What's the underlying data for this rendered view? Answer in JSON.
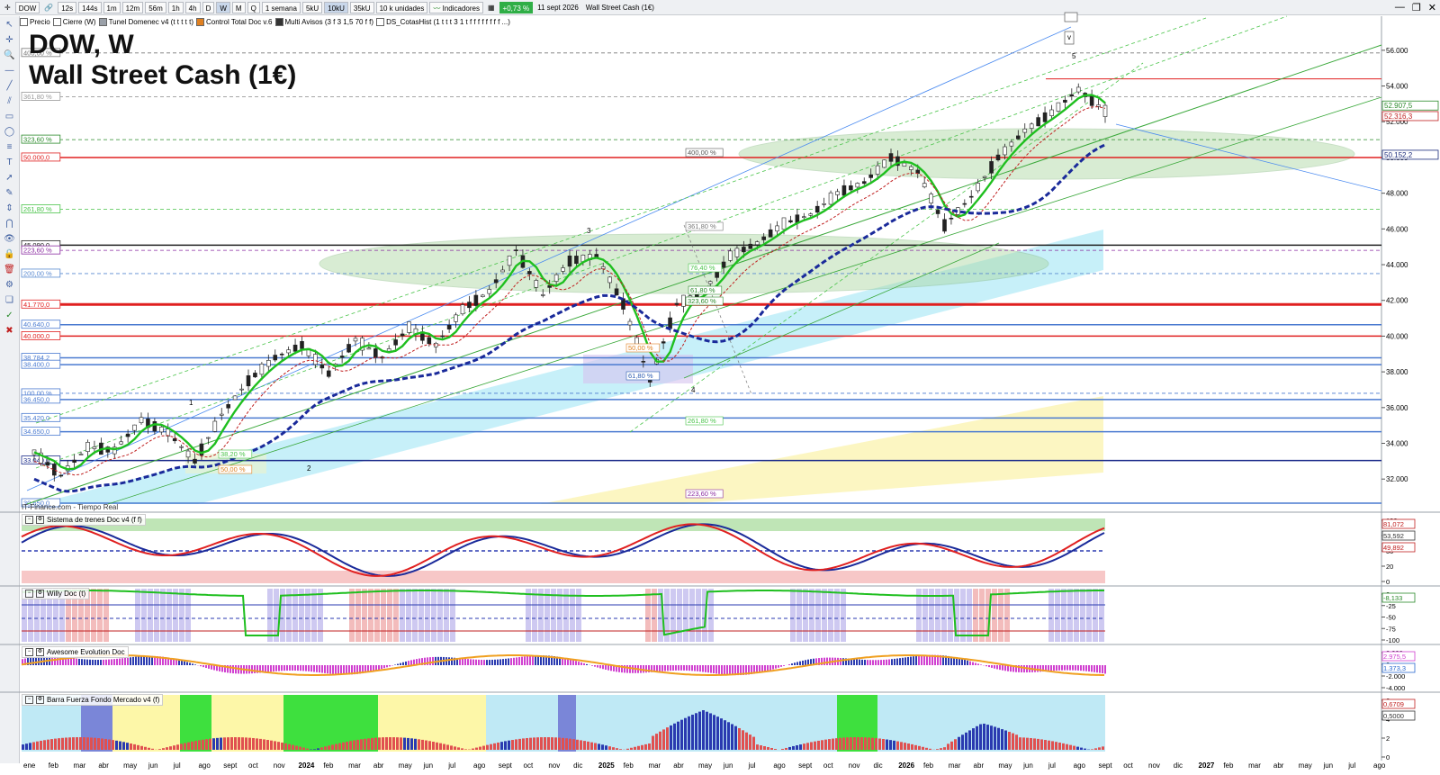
{
  "toolbar": {
    "symbol": "DOW",
    "timeframes": [
      "12s",
      "144s",
      "1m",
      "12m",
      "56m",
      "1h",
      "4h",
      "D",
      "W",
      "M",
      "Q"
    ],
    "active_timeframe": "W",
    "period": "1 semana",
    "units": [
      "5kU",
      "10kU",
      "35kU"
    ],
    "active_unit": "10kU",
    "units_select": "10 k unidades",
    "indicators_label": "Indicadores",
    "change_badge": "+0,73 %",
    "date_label": "11 sept 2026",
    "instrument_label": "Wall Street Cash (1€)"
  },
  "legend": [
    "Precio",
    "Cierre (W)",
    "Tunel Domenec v4 (t t t t t)",
    "Control Total Doc v.6",
    "Multi Avisos (3 f 3 1,5 70 f f)",
    "DS_CotasHist (1 t t t 3 1 t f f f f f f f f ...)"
  ],
  "title_line1": "DOW, W",
  "title_line2": "Wall Street Cash (1€)",
  "source_label": "IT-Finance.com - Tiempo Real",
  "price_axis": {
    "ticks": [
      {
        "label": "56.000",
        "y": 56000
      },
      {
        "label": "54.000",
        "y": 54000
      },
      {
        "label": "52.000",
        "y": 52000
      },
      {
        "label": "50.000",
        "y": 50000
      },
      {
        "label": "48.000",
        "y": 48000
      },
      {
        "label": "46.000",
        "y": 46000
      },
      {
        "label": "44.000",
        "y": 44000
      },
      {
        "label": "42.000",
        "y": 42000
      },
      {
        "label": "40.000",
        "y": 40000
      },
      {
        "label": "38.000",
        "y": 38000
      },
      {
        "label": "36.000",
        "y": 36000
      },
      {
        "label": "34.000",
        "y": 34000
      },
      {
        "label": "32.000",
        "y": 32000
      }
    ],
    "badges": [
      {
        "label": "52.907,5",
        "value": 52907,
        "color": "#2a8a2a"
      },
      {
        "label": "52.316,3",
        "value": 52316,
        "color": "#c02020"
      },
      {
        "label": "50.152,2",
        "value": 50152,
        "color": "#1a2a7a"
      }
    ]
  },
  "left_levels": [
    {
      "label": "400,00 %",
      "value": 55850,
      "color": "#777777",
      "dash": true
    },
    {
      "label": "361,80 %",
      "value": 53400,
      "color": "#999999",
      "dash": true
    },
    {
      "label": "323,60 %",
      "value": 51000,
      "color": "#2a8a2a",
      "dash": true
    },
    {
      "label": "50.000,0",
      "value": 50000,
      "color": "#e02020",
      "dash": false
    },
    {
      "label": "261,80 %",
      "value": 47100,
      "color": "#4ac44a",
      "dash": true
    },
    {
      "label": "45.090,0",
      "value": 45090,
      "color": "#222222",
      "dash": false
    },
    {
      "label": "223,60 %",
      "value": 44800,
      "color": "#8a2aa0",
      "dash": true
    },
    {
      "label": "200,00 %",
      "value": 43500,
      "color": "#5a8ad0",
      "dash": true
    },
    {
      "label": "41.770,0",
      "value": 41770,
      "color": "#e02020",
      "dash": false
    },
    {
      "label": "40.640,0",
      "value": 40640,
      "color": "#4a7ad0",
      "dash": false
    },
    {
      "label": "40.000,0",
      "value": 40000,
      "color": "#e02020",
      "dash": false
    },
    {
      "label": "38.784,2",
      "value": 38784,
      "color": "#4a7ad0",
      "dash": false
    },
    {
      "label": "38.400,0",
      "value": 38400,
      "color": "#4a7ad0",
      "dash": false
    },
    {
      "label": "100,00 %",
      "value": 36800,
      "color": "#4a7ad0",
      "dash": true
    },
    {
      "label": "36.450,0",
      "value": 36450,
      "color": "#4a7ad0",
      "dash": false
    },
    {
      "label": "35.420,0",
      "value": 35420,
      "color": "#4a7ad0",
      "dash": false
    },
    {
      "label": "34.650,0",
      "value": 34650,
      "color": "#4a7ad0",
      "dash": false
    },
    {
      "label": "33.040,0",
      "value": 33040,
      "color": "#1a2a8a",
      "dash": false
    },
    {
      "label": "30.650,0",
      "value": 30650,
      "color": "#4a7ad0",
      "dash": false
    }
  ],
  "fib_labels": [
    {
      "label": "400,00 %",
      "color": "#555555"
    },
    {
      "label": "361,80 %",
      "color": "#777777"
    },
    {
      "label": "323,60 %",
      "color": "#2a8a2a"
    },
    {
      "label": "261,80 %",
      "color": "#4ac44a"
    },
    {
      "label": "223,60 %",
      "color": "#8a2aa0"
    },
    {
      "label": "76,40 %",
      "color": "#4ac44a"
    },
    {
      "label": "61,80 %",
      "color": "#2a8a2a"
    },
    {
      "label": "50,00 %",
      "color": "#e08020"
    },
    {
      "label": "61,80 %",
      "color": "#2a5ab0"
    },
    {
      "label": "38,20 %",
      "color": "#4ac44a"
    },
    {
      "label": "50,00 %",
      "color": "#e08020"
    }
  ],
  "wave_labels": [
    "1",
    "2",
    "3",
    "4",
    "5",
    "v"
  ],
  "time_axis": [
    "ene",
    "feb",
    "mar",
    "abr",
    "may",
    "jun",
    "jul",
    "ago",
    "sept",
    "oct",
    "nov",
    "2024",
    "feb",
    "mar",
    "abr",
    "may",
    "jun",
    "jul",
    "ago",
    "sept",
    "oct",
    "nov",
    "dic",
    "2025",
    "feb",
    "mar",
    "abr",
    "may",
    "jun",
    "jul",
    "ago",
    "sept",
    "oct",
    "nov",
    "dic",
    "2026",
    "feb",
    "mar",
    "abr",
    "may",
    "jun",
    "jul",
    "ago",
    "sept",
    "oct",
    "nov",
    "dic",
    "2027",
    "feb",
    "mar",
    "abr",
    "may",
    "jun",
    "jul",
    "ago"
  ],
  "time_axis_bold": [
    "2024",
    "2025",
    "2026",
    "2027"
  ],
  "panels": [
    {
      "title": "Sistema de trenes Doc v4 (f f)",
      "axis": [
        "100",
        "80",
        "50",
        "20",
        "0"
      ],
      "badges": [
        {
          "label": "81,072",
          "color": "#c02020"
        },
        {
          "label": "53,592",
          "color": "#333333"
        },
        {
          "label": "49,892",
          "color": "#c02020"
        }
      ]
    },
    {
      "title": "Willy Doc (t)",
      "axis": [
        "0",
        "-25",
        "-50",
        "-75",
        "-100"
      ],
      "badges": [
        {
          "label": "-8,133",
          "color": "#2a8a2a"
        }
      ]
    },
    {
      "title": "Awesome Evolution Doc",
      "axis": [
        "2.000",
        "0",
        "-2.000",
        "-4.000"
      ],
      "badges": [
        {
          "label": "2.975,5",
          "color": "#d040d0"
        },
        {
          "label": "1.373,3",
          "color": "#2a6ad0"
        }
      ]
    },
    {
      "title": "Barra Fuerza Fondo Mercado v4 (f)",
      "axis": [
        "6",
        "4",
        "2",
        "0"
      ],
      "badges": [
        {
          "label": "0,6709",
          "color": "#c02020"
        },
        {
          "label": "0,5000",
          "color": "#333333"
        }
      ]
    }
  ],
  "chart_data": {
    "type": "candlestick",
    "title": "DOW, W",
    "subtitle": "Wall Street Cash (1€)",
    "ylim": [
      30600,
      57000
    ],
    "weekly_close_path": [
      {
        "x": "2023-01",
        "y": 33500
      },
      {
        "x": "2023-03",
        "y": 32200
      },
      {
        "x": "2023-04",
        "y": 33800
      },
      {
        "x": "2023-06",
        "y": 33600
      },
      {
        "x": "2023-07",
        "y": 35300
      },
      {
        "x": "2023-08",
        "y": 34600
      },
      {
        "x": "2023-10",
        "y": 33000
      },
      {
        "x": "2023-11",
        "y": 35600
      },
      {
        "x": "2023-12",
        "y": 37500
      },
      {
        "x": "2024-02",
        "y": 38800
      },
      {
        "x": "2024-03",
        "y": 39500
      },
      {
        "x": "2024-04",
        "y": 37900
      },
      {
        "x": "2024-05",
        "y": 39800
      },
      {
        "x": "2024-06",
        "y": 38800
      },
      {
        "x": "2024-07",
        "y": 40500
      },
      {
        "x": "2024-08",
        "y": 39500
      },
      {
        "x": "2024-09",
        "y": 41500
      },
      {
        "x": "2024-10",
        "y": 42500
      },
      {
        "x": "2024-11",
        "y": 44800
      },
      {
        "x": "2024-12",
        "y": 42300
      },
      {
        "x": "2025-01",
        "y": 44200
      },
      {
        "x": "2025-02",
        "y": 44500
      },
      {
        "x": "2025-03",
        "y": 41800
      },
      {
        "x": "2025-04",
        "y": 37500
      },
      {
        "x": "2025-05",
        "y": 41800
      },
      {
        "x": "2025-06",
        "y": 42500
      },
      {
        "x": "2025-07",
        "y": 44500
      },
      {
        "x": "2025-08",
        "y": 45200
      },
      {
        "x": "2025-09",
        "y": 46300
      },
      {
        "x": "2025-10",
        "y": 46800
      },
      {
        "x": "2025-11",
        "y": 48000
      },
      {
        "x": "2025-12",
        "y": 48600
      },
      {
        "x": "2026-01",
        "y": 50000
      },
      {
        "x": "2026-02",
        "y": 49200
      },
      {
        "x": "2026-03",
        "y": 46200
      },
      {
        "x": "2026-04",
        "y": 47800
      },
      {
        "x": "2026-05",
        "y": 50000
      },
      {
        "x": "2026-06",
        "y": 51500
      },
      {
        "x": "2026-07",
        "y": 52500
      },
      {
        "x": "2026-08",
        "y": 53800
      },
      {
        "x": "2026-09",
        "y": 52600
      }
    ],
    "horizontal_levels": [
      54400,
      50000,
      45090,
      41770,
      40000,
      38400,
      36450,
      35420,
      34650,
      33040,
      30650
    ]
  }
}
